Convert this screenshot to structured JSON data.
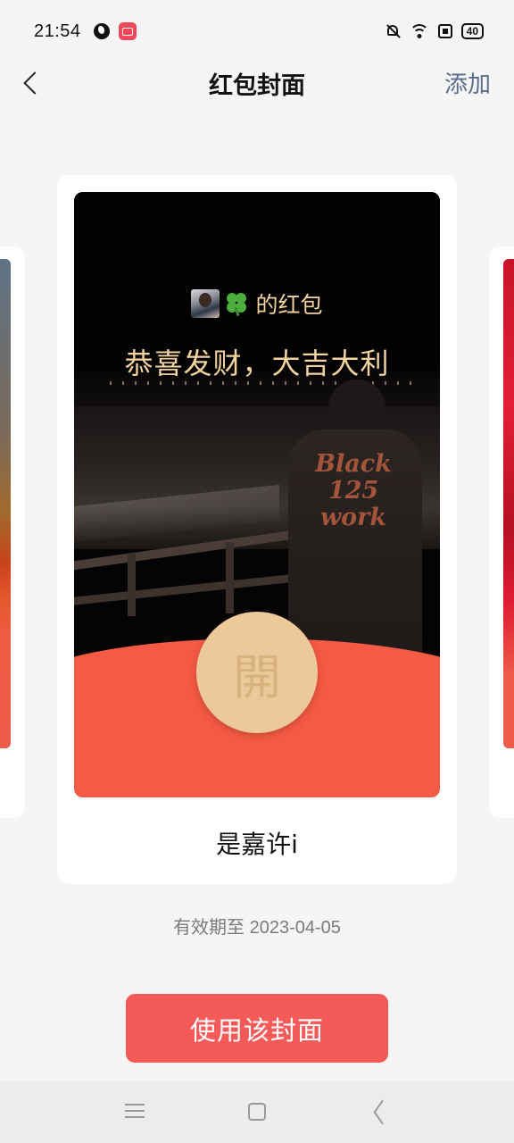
{
  "status_bar": {
    "time": "21:54",
    "battery": "40",
    "icons": [
      "globe-icon",
      "app-notification-icon",
      "bell-off-icon",
      "wifi-icon",
      "sim-icon",
      "battery-icon"
    ]
  },
  "header": {
    "title": "红包封面",
    "action_label": "添加",
    "back_icon": "chevron-left-icon"
  },
  "cover": {
    "sender_suffix": "的红包",
    "blessing": "恭喜发财，大吉大利",
    "open_label": "開",
    "photo_print": "Black 125 work",
    "name": "是嘉许i"
  },
  "validity": "有效期至 2023-04-05",
  "primary_button": "使用该封面",
  "system_nav": {
    "icons": [
      "menu-icon",
      "home-icon",
      "back-icon"
    ]
  },
  "colors": {
    "accent_red": "#f45a58",
    "packet_red": "#f45a45",
    "gold_text": "#f3d39e",
    "open_button": "#ecc99b",
    "link_blue": "#5b6b8c"
  }
}
